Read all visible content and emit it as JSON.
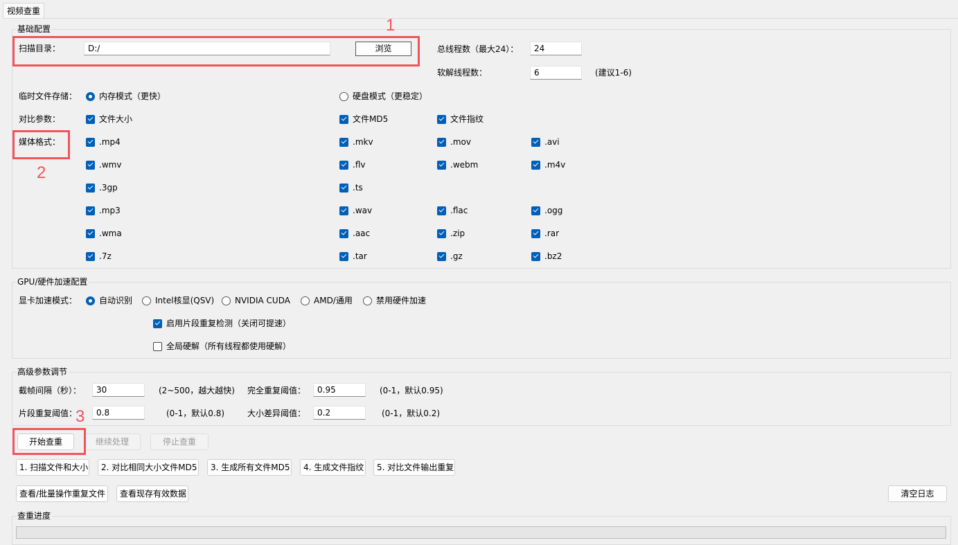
{
  "tab": {
    "label": "视频查重"
  },
  "basic": {
    "title": "基础配置",
    "scan_dir_label": "扫描目录：",
    "scan_dir_value": "D:/",
    "browse_label": "浏览",
    "total_threads_label": "总线程数（最大24）：",
    "total_threads_value": "24",
    "soft_threads_label": "软解线程数：",
    "soft_threads_value": "6",
    "soft_threads_hint": "(建议1-6)",
    "temp_label": "临时文件存储：",
    "temp_options": [
      {
        "label": "内存模式（更快）",
        "selected": true
      },
      {
        "label": "硬盘模式（更稳定）",
        "selected": false
      }
    ],
    "compare_label": "对比参数：",
    "compare_options": [
      {
        "label": "文件大小",
        "checked": true
      },
      {
        "label": "文件MD5",
        "checked": true
      },
      {
        "label": "文件指纹",
        "checked": true
      }
    ],
    "media_label": "媒体格式：",
    "formats": [
      ".mp4",
      ".mkv",
      ".mov",
      ".avi",
      ".wmv",
      ".flv",
      ".webm",
      ".m4v",
      ".3gp",
      ".ts",
      ".mp3",
      ".wav",
      ".flac",
      ".ogg",
      ".wma",
      ".aac",
      ".zip",
      ".rar",
      ".7z",
      ".tar",
      ".gz",
      ".bz2"
    ]
  },
  "gpu": {
    "title": "GPU/硬件加速配置",
    "mode_label": "显卡加速模式：",
    "modes": [
      {
        "label": "自动识别",
        "selected": true
      },
      {
        "label": "Intel核显(QSV)",
        "selected": false
      },
      {
        "label": "NVIDIA CUDA",
        "selected": false
      },
      {
        "label": "AMD/通用",
        "selected": false
      },
      {
        "label": "禁用硬件加速",
        "selected": false
      }
    ],
    "segment_check": {
      "label": "启用片段重复检测（关闭可提速）",
      "checked": true
    },
    "global_hw": {
      "label": "全局硬解（所有线程都使用硬解）",
      "checked": false
    }
  },
  "advanced": {
    "title": "高级参数调节",
    "frame_interval_label": "截帧间隔（秒）：",
    "frame_interval_value": "30",
    "frame_interval_hint": "(2~500，越大越快)",
    "full_dup_label": "完全重复阈值：",
    "full_dup_value": "0.95",
    "full_dup_hint": "(0-1，默认0.95)",
    "seg_dup_label": "片段重复阈值：",
    "seg_dup_value": "0.8",
    "seg_dup_hint": "(0-1，默认0.8)",
    "size_diff_label": "大小差异阈值：",
    "size_diff_value": "0.2",
    "size_diff_hint": "(0-1，默认0.2)"
  },
  "actions": {
    "start": "开始查重",
    "continue": "继续处理",
    "stop": "停止查重",
    "steps": [
      "1. 扫描文件和大小",
      "2. 对比相同大小文件MD5",
      "3. 生成所有文件MD5",
      "4. 生成文件指纹",
      "5. 对比文件输出重复"
    ],
    "view_batch": "查看/批量操作重复文件",
    "view_valid": "查看现存有效数据",
    "clear_log": "清空日志"
  },
  "progress": {
    "title": "查重进度",
    "value": 0
  },
  "annotations": [
    "1",
    "2",
    "3"
  ],
  "colors": {
    "accent": "#005fb8",
    "annotation": "#f0545b",
    "background": "#f0f0f0"
  }
}
